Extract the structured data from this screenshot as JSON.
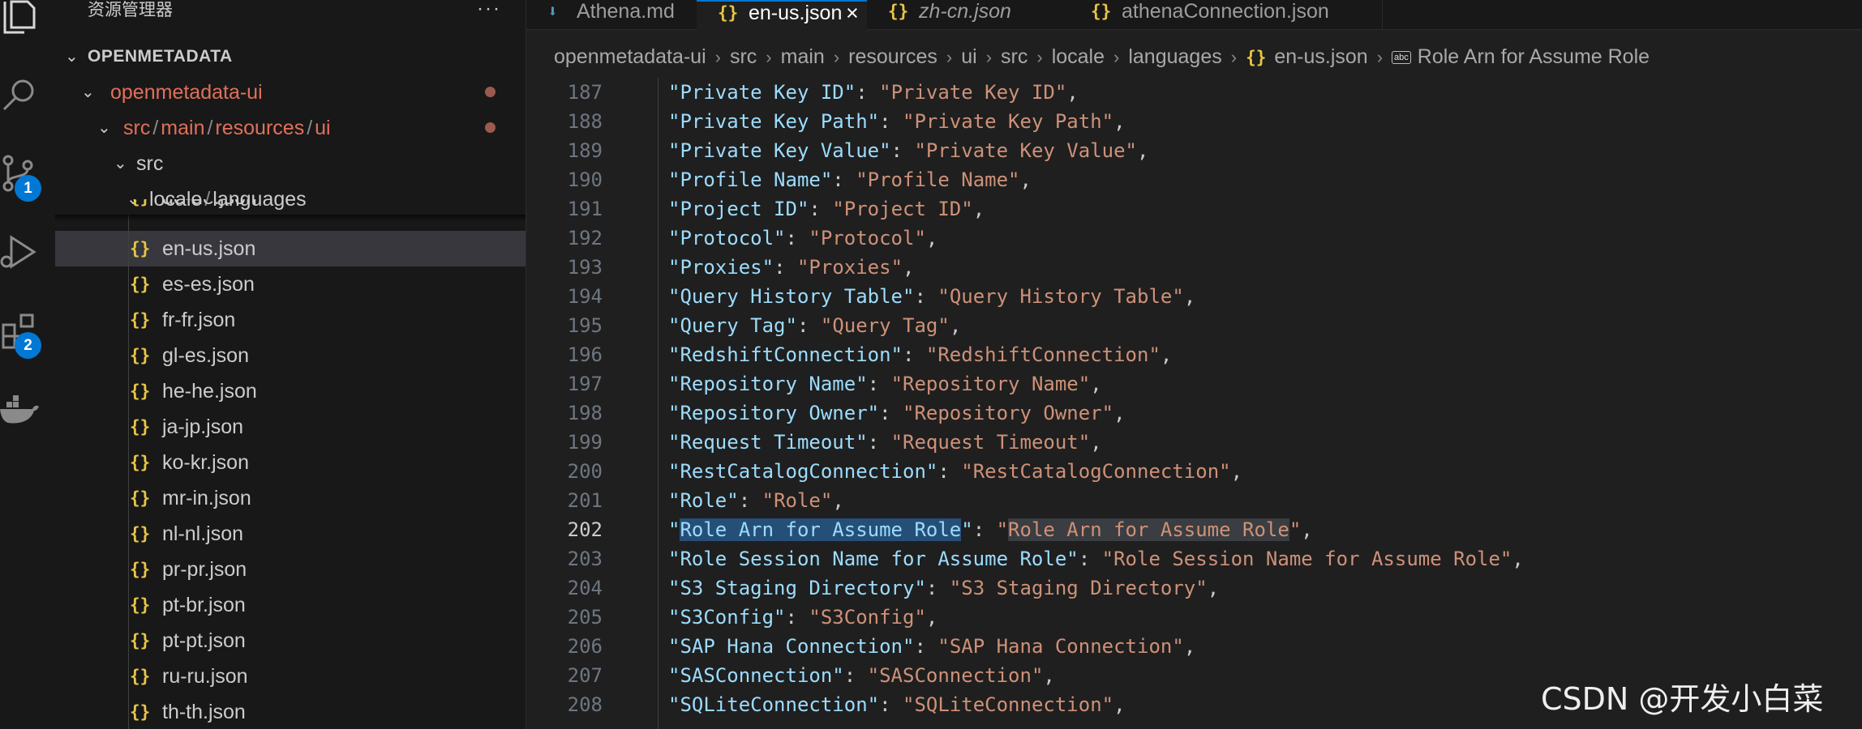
{
  "activity_bar": {
    "icons": [
      "files-icon",
      "search-icon",
      "source-control-icon",
      "run-debug-icon",
      "extensions-icon",
      "docker-icon"
    ],
    "source_control_badge": "1",
    "extensions_badge": "2",
    "badge_color": "#0078d4"
  },
  "sidebar": {
    "title": "资源管理器",
    "more": "···",
    "root": "OPENMETADATA",
    "folders": {
      "ui_root": "openmetadata-ui",
      "path_parts": [
        "src",
        "main",
        "resources",
        "ui"
      ],
      "src": "src",
      "locale": "locale",
      "languages": "languages"
    },
    "partial_file": "de-de.json",
    "files": [
      "en-us.json",
      "es-es.json",
      "fr-fr.json",
      "gl-es.json",
      "he-he.json",
      "ja-jp.json",
      "ko-kr.json",
      "mr-in.json",
      "nl-nl.json",
      "pr-pr.json",
      "pt-br.json",
      "pt-pt.json",
      "ru-ru.json",
      "th-th.json"
    ],
    "json_icon": "{}"
  },
  "tabs": [
    {
      "label": "Athena.md",
      "icon": "⬇",
      "italic": false,
      "active": false
    },
    {
      "label": "en-us.json",
      "icon": "{}",
      "italic": false,
      "active": true,
      "close": "×"
    },
    {
      "label": "zh-cn.json",
      "icon": "{}",
      "italic": true,
      "active": false
    },
    {
      "label": "athenaConnection.json",
      "icon": "{}",
      "italic": false,
      "active": false
    }
  ],
  "breadcrumb": {
    "parts": [
      "openmetadata-ui",
      "src",
      "main",
      "resources",
      "ui",
      "src",
      "locale",
      "languages"
    ],
    "file": "en-us.json",
    "symbol": "Role Arn for Assume Role",
    "symbol_icon_text": "abc",
    "separator": "›"
  },
  "editor": {
    "current_line": 202,
    "lines": [
      {
        "n": 187,
        "key": "Private Key ID",
        "value": "Private Key ID"
      },
      {
        "n": 188,
        "key": "Private Key Path",
        "value": "Private Key Path"
      },
      {
        "n": 189,
        "key": "Private Key Value",
        "value": "Private Key Value"
      },
      {
        "n": 190,
        "key": "Profile Name",
        "value": "Profile Name"
      },
      {
        "n": 191,
        "key": "Project ID",
        "value": "Project ID"
      },
      {
        "n": 192,
        "key": "Protocol",
        "value": "Protocol"
      },
      {
        "n": 193,
        "key": "Proxies",
        "value": "Proxies"
      },
      {
        "n": 194,
        "key": "Query History Table",
        "value": "Query History Table"
      },
      {
        "n": 195,
        "key": "Query Tag",
        "value": "Query Tag"
      },
      {
        "n": 196,
        "key": "RedshiftConnection",
        "value": "RedshiftConnection"
      },
      {
        "n": 197,
        "key": "Repository Name",
        "value": "Repository Name"
      },
      {
        "n": 198,
        "key": "Repository Owner",
        "value": "Repository Owner"
      },
      {
        "n": 199,
        "key": "Request Timeout",
        "value": "Request Timeout"
      },
      {
        "n": 200,
        "key": "RestCatalogConnection",
        "value": "RestCatalogConnection"
      },
      {
        "n": 201,
        "key": "Role",
        "value": "Role"
      },
      {
        "n": 202,
        "key": "Role Arn for Assume Role",
        "value": "Role Arn for Assume Role"
      },
      {
        "n": 203,
        "key": "Role Session Name for Assume Role",
        "value": "Role Session Name for Assume Role"
      },
      {
        "n": 204,
        "key": "S3 Staging Directory",
        "value": "S3 Staging Directory"
      },
      {
        "n": 205,
        "key": "S3Config",
        "value": "S3Config"
      },
      {
        "n": 206,
        "key": "SAP Hana Connection",
        "value": "SAP Hana Connection"
      },
      {
        "n": 207,
        "key": "SASConnection",
        "value": "SASConnection"
      },
      {
        "n": 208,
        "key": "SQLiteConnection",
        "value": "SQLiteConnection"
      }
    ]
  },
  "watermark": "CSDN @开发小白菜"
}
